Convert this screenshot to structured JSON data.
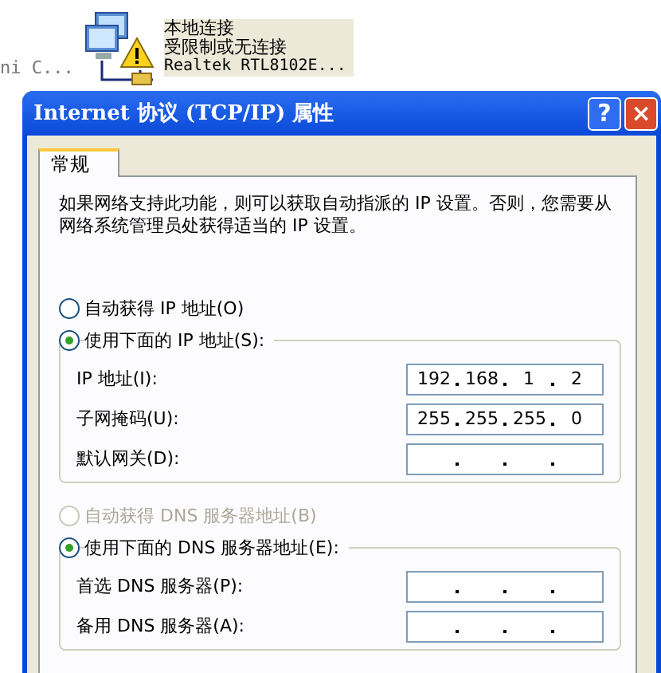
{
  "background": {
    "cut_label": "ni C...",
    "connection": {
      "name": "本地连接",
      "status": "受限制或无连接",
      "device": "Realtek RTL8102E..."
    }
  },
  "dialog": {
    "title": "Internet 协议 (TCP/IP) 属性",
    "title_buttons": [
      {
        "kind": "help",
        "label": "?"
      },
      {
        "kind": "close",
        "label": "×"
      }
    ],
    "tabs": [
      {
        "label": "常规",
        "selected": true
      }
    ],
    "description": "如果网络支持此功能，则可以获取自动指派的 IP 设置。否则，您需要从网络系统管理员处获得适当的 IP 设置。",
    "sections": [
      {
        "options": [
          {
            "label": "自动获得 IP 地址(O)",
            "selected": false,
            "disabled": false
          },
          {
            "label": "使用下面的 IP 地址(S):",
            "selected": true,
            "disabled": false
          }
        ],
        "fields": [
          {
            "label": "IP 地址(I):",
            "octets": [
              "192",
              "168",
              "1",
              "2"
            ]
          },
          {
            "label": "子网掩码(U):",
            "octets": [
              "255",
              "255",
              "255",
              "0"
            ]
          },
          {
            "label": "默认网关(D):"
          }
        ]
      },
      {
        "options": [
          {
            "label": "自动获得 DNS 服务器地址(B)",
            "selected": false,
            "disabled": true
          },
          {
            "label": "使用下面的 DNS 服务器地址(E):",
            "selected": true,
            "disabled": false
          }
        ],
        "fields": [
          {
            "label": "首选 DNS 服务器(P):"
          },
          {
            "label": "备用 DNS 服务器(A):"
          }
        ]
      }
    ]
  }
}
